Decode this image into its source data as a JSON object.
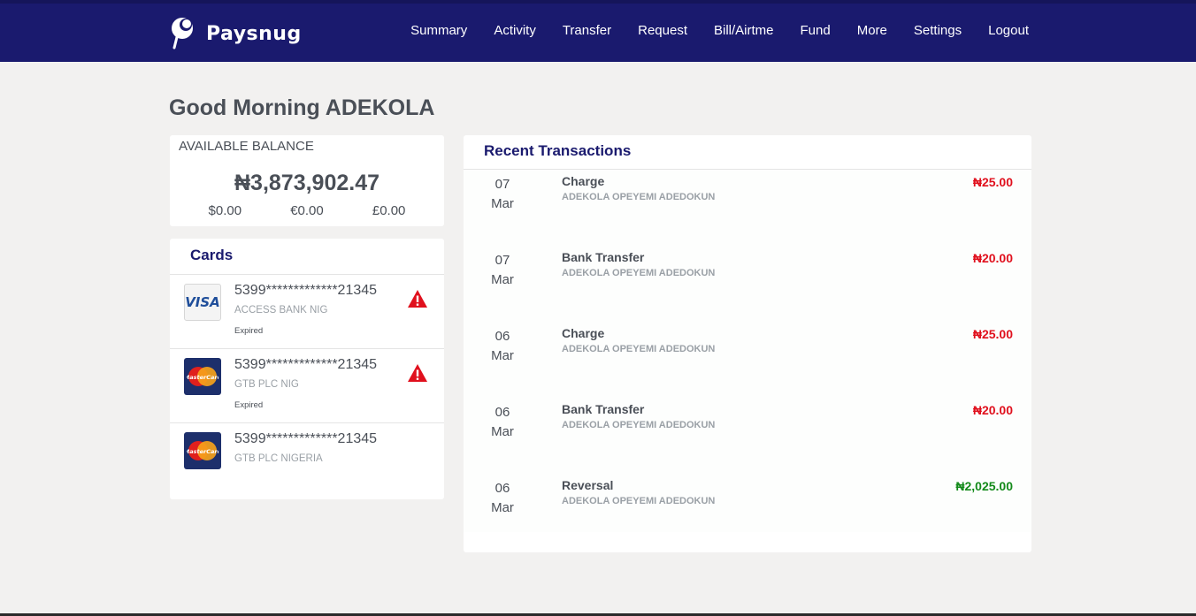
{
  "brand": {
    "name": "Paysnug"
  },
  "nav": [
    "Summary",
    "Activity",
    "Transfer",
    "Request",
    "Bill/Airtme",
    "Fund",
    "More",
    "Settings",
    "Logout"
  ],
  "greeting": "Good Morning ADEKOLA",
  "balance": {
    "label": "AVAILABLE BALANCE",
    "amount": "₦3,873,902.47",
    "usd": "$0.00",
    "eur": "€0.00",
    "gbp": "£0.00"
  },
  "cards": {
    "title": "Cards",
    "items": [
      {
        "number": "5399*************21345",
        "bank": "ACCESS BANK NIG",
        "status": "Expired",
        "type_icon": "visa-icon",
        "brand_text": "VISA",
        "warning_icon": "warning-icon"
      },
      {
        "number": "5399*************21345",
        "bank": "GTB PLC NIG",
        "status": "Expired",
        "type_icon": "mastercard-icon",
        "brand_text": "MasterCard",
        "warning_icon": "warning-icon"
      },
      {
        "number": "5399*************21345",
        "bank": "GTB PLC NIGERIA",
        "status": "",
        "type_icon": "mastercard-icon",
        "brand_text": "MasterCard"
      }
    ]
  },
  "recent": {
    "title": "Recent Transactions",
    "items": [
      {
        "day": "07",
        "month": "Mar",
        "title": "Charge",
        "name": "ADEKOLA OPEYEMI ADEDOKUN",
        "amount": "₦25.00",
        "direction": "debit"
      },
      {
        "day": "07",
        "month": "Mar",
        "title": "Bank Transfer",
        "name": "ADEKOLA OPEYEMI ADEDOKUN",
        "amount": "₦20.00",
        "direction": "debit"
      },
      {
        "day": "06",
        "month": "Mar",
        "title": "Charge",
        "name": "ADEKOLA OPEYEMI ADEDOKUN",
        "amount": "₦25.00",
        "direction": "debit"
      },
      {
        "day": "06",
        "month": "Mar",
        "title": "Bank Transfer",
        "name": "ADEKOLA OPEYEMI ADEDOKUN",
        "amount": "₦20.00",
        "direction": "debit"
      },
      {
        "day": "06",
        "month": "Mar",
        "title": "Reversal",
        "name": "ADEKOLA OPEYEMI ADEDOKUN",
        "amount": "₦2,025.00",
        "direction": "credit"
      }
    ]
  },
  "colors": {
    "navbar": "#1a1a6e",
    "debit": "#e0101d",
    "credit": "#138a1a",
    "warning": "#e0101d"
  }
}
